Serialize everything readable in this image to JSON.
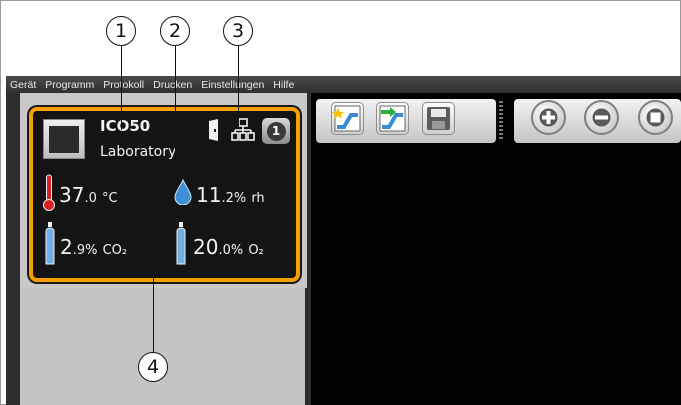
{
  "callouts": [
    "1",
    "2",
    "3",
    "4"
  ],
  "menu": [
    "Gerät",
    "Programm",
    "Protokoll",
    "Drucken",
    "Einstellungen",
    "Hilfe"
  ],
  "device": {
    "name": "ICO50",
    "location": "Laboratory",
    "status_badge": "1",
    "temperature": {
      "value": "37",
      "decimal": ".0",
      "unit": "°C"
    },
    "humidity": {
      "value": "11",
      "decimal": ".2%",
      "unit": "rh"
    },
    "co2": {
      "value": "2",
      "decimal": ".9%",
      "unit": "CO₂"
    },
    "o2": {
      "value": "20",
      "decimal": ".0%",
      "unit": "O₂"
    }
  },
  "colors": {
    "card_border": "#f5a000",
    "card_bg": "#141414",
    "thermometer": "#d92020",
    "humidity_drop": "#3d8fd8",
    "gas_bottle": "#6fb0e6"
  },
  "icons": [
    "device-image-icon",
    "door-icon",
    "network-icon",
    "thermometer-icon",
    "humidity-drop-icon",
    "co2-bottle-icon",
    "o2-bottle-icon",
    "new-program-icon",
    "open-program-icon",
    "save-icon",
    "zoom-in-icon",
    "zoom-out-icon",
    "stop-icon"
  ]
}
